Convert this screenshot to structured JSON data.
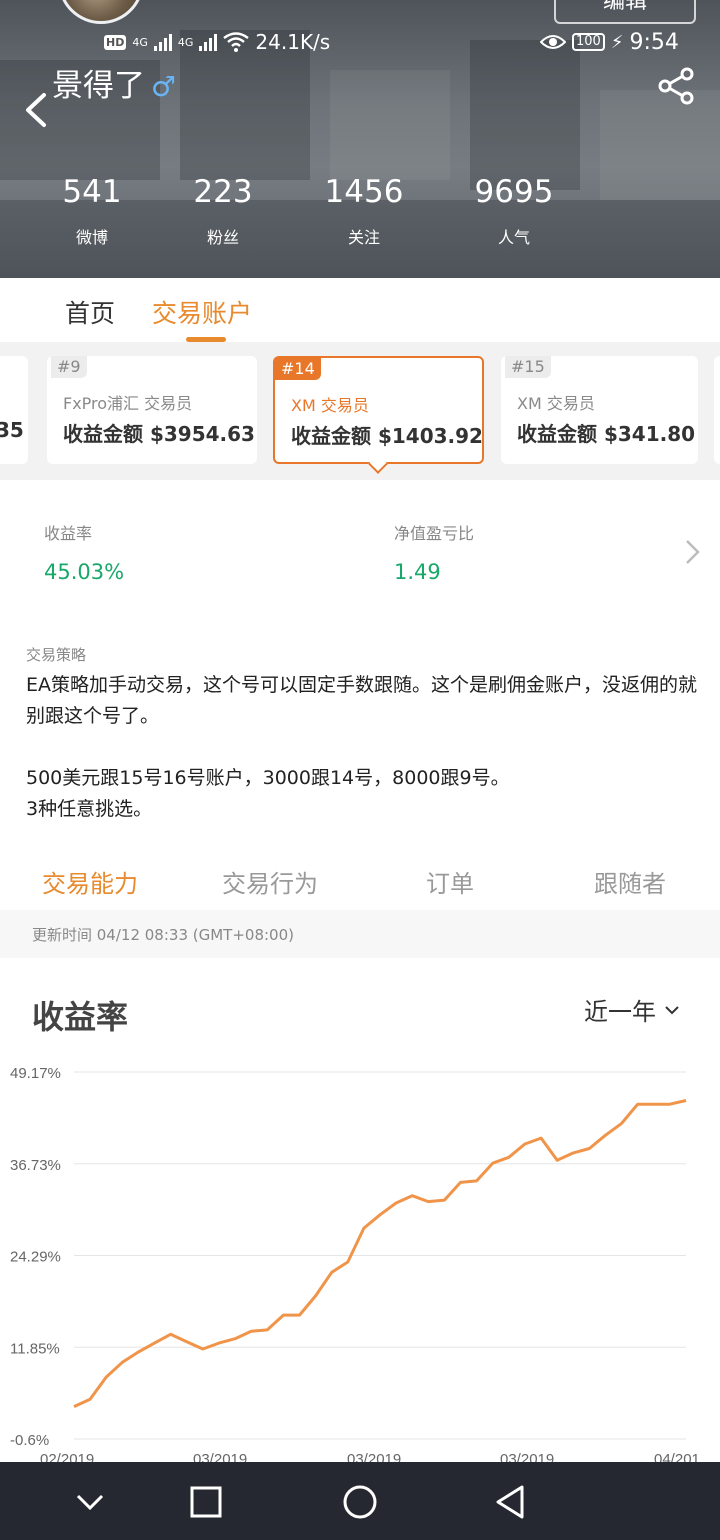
{
  "status_bar": {
    "hd": "HD",
    "net1": "4G",
    "net2": "4G",
    "speed": "24.1K/s",
    "battery": "100",
    "time": "9:54"
  },
  "profile": {
    "edit_label": "编辑",
    "name": "景得了",
    "gender_symbol": "♂",
    "stats": [
      {
        "value": "541",
        "label": "微博"
      },
      {
        "value": "223",
        "label": "粉丝"
      },
      {
        "value": "1456",
        "label": "关注"
      },
      {
        "value": "9695",
        "label": "人气"
      }
    ]
  },
  "top_tabs": [
    "首页",
    "交易账户"
  ],
  "accounts": [
    {
      "rank": "",
      "type": "",
      "amount": "35"
    },
    {
      "rank": "#9",
      "type": "FxPro浦汇 交易员",
      "amount": "收益金额 $3954.63"
    },
    {
      "rank": "#14",
      "type": "XM 交易员",
      "amount": "收益金额 $1403.92"
    },
    {
      "rank": "#15",
      "type": "XM 交易员",
      "amount": "收益金额 $341.80"
    }
  ],
  "metrics": [
    {
      "label": "收益率",
      "value": "45.03%"
    },
    {
      "label": "净值盈亏比",
      "value": "1.49"
    }
  ],
  "strategy": {
    "label": "交易策略",
    "lines": [
      "EA策略加手动交易，这个号可以固定手数跟随。这个是刷佣金账户，没返佣的就别跟这个号了。",
      "",
      "500美元跟15号16号账户，3000跟14号，8000跟9号。",
      "3种任意挑选。"
    ]
  },
  "section_tabs": [
    "交易能力",
    "交易行为",
    "订单",
    "跟随者"
  ],
  "update_time": "更新时间 04/12 08:33 (GMT+08:00)",
  "chart_title": "收益率",
  "range_label": "近一年",
  "chart_data": {
    "type": "line",
    "title": "收益率",
    "y_ticks": [
      "49.17%",
      "36.73%",
      "24.29%",
      "11.85%",
      "-0.6%"
    ],
    "ylim": [
      -0.6,
      49.17
    ],
    "x_ticks": [
      "02/2019",
      "03/2019",
      "03/2019",
      "03/2019",
      "04/201"
    ],
    "grid": true,
    "color": "#f0944a",
    "series": [
      {
        "values": [
          3.8,
          4.8,
          7.8,
          9.8,
          11.2,
          12.4,
          13.6,
          12.6,
          11.6,
          12.4,
          13.0,
          14.0,
          14.2,
          16.2,
          16.2,
          18.8,
          22.0,
          23.4,
          28.0,
          29.8,
          31.4,
          32.4,
          31.6,
          31.8,
          34.2,
          34.4,
          36.8,
          37.6,
          39.4,
          40.2,
          37.2,
          38.2,
          38.8,
          40.6,
          42.2,
          44.8,
          44.8,
          44.8,
          45.3
        ]
      }
    ]
  },
  "nav": {
    "color": "#252830"
  }
}
